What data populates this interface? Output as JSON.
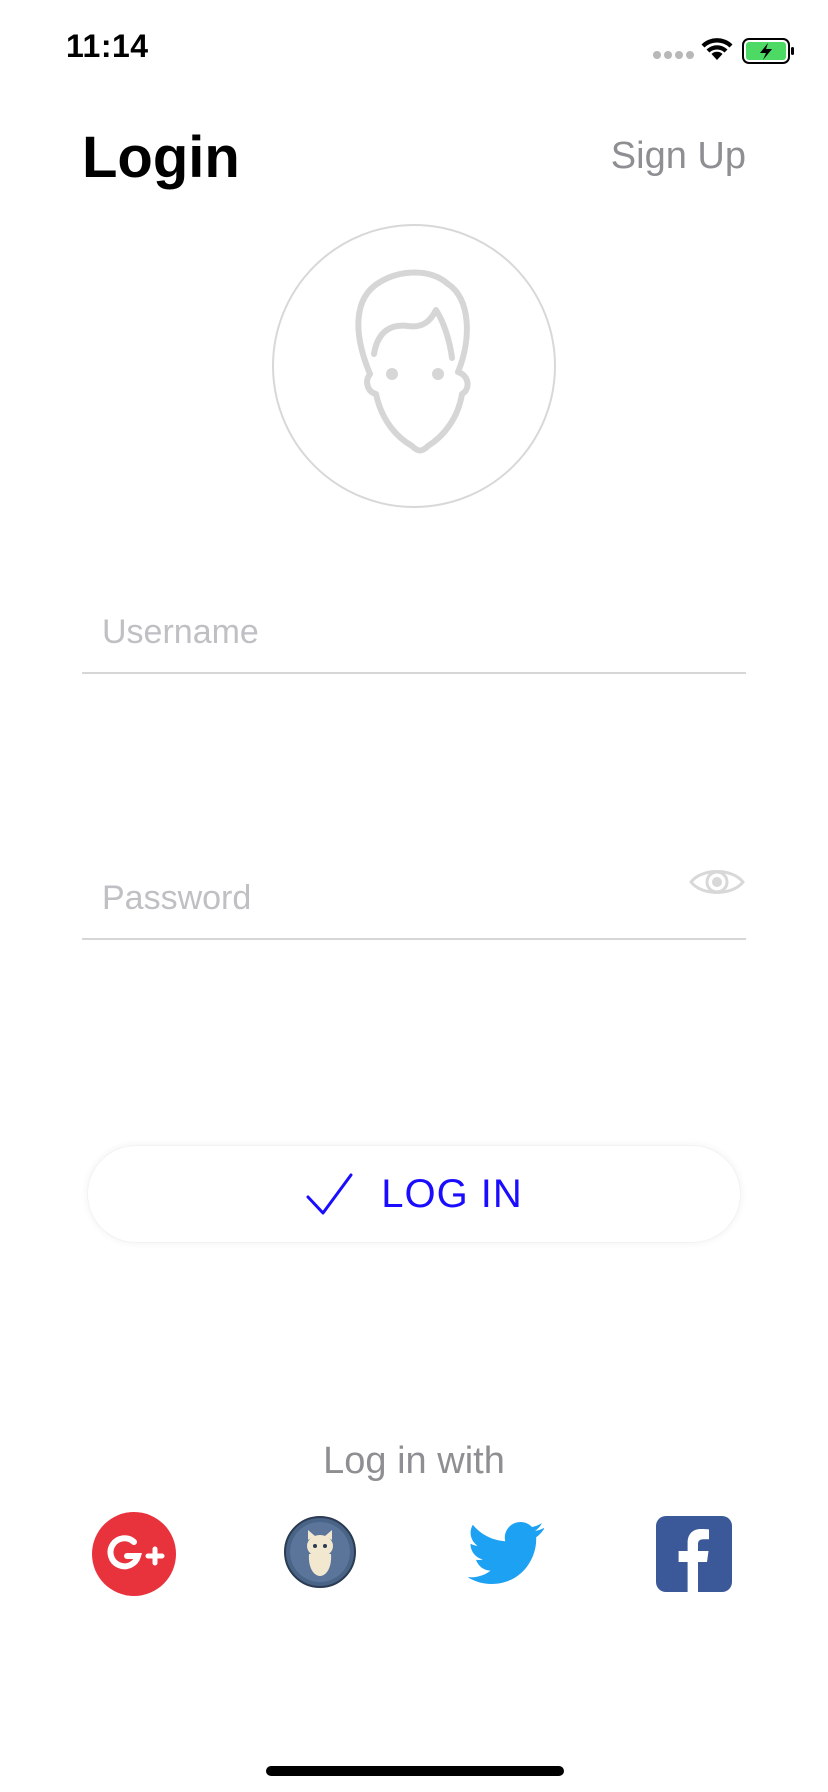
{
  "status_bar": {
    "time": "11:14"
  },
  "header": {
    "title": "Login",
    "signup_label": "Sign Up"
  },
  "form": {
    "username_placeholder": "Username",
    "password_placeholder": "Password"
  },
  "login_button": {
    "label": "LOG IN"
  },
  "social": {
    "title": "Log in with",
    "providers": [
      "google-plus-icon",
      "github-icon",
      "twitter-icon",
      "facebook-icon"
    ]
  },
  "colors": {
    "accent": "#1a0dff",
    "muted": "#8e8e93",
    "google": "#e8323c",
    "twitter": "#1da1f2",
    "facebook": "#3b5998",
    "battery": "#4cd964"
  }
}
